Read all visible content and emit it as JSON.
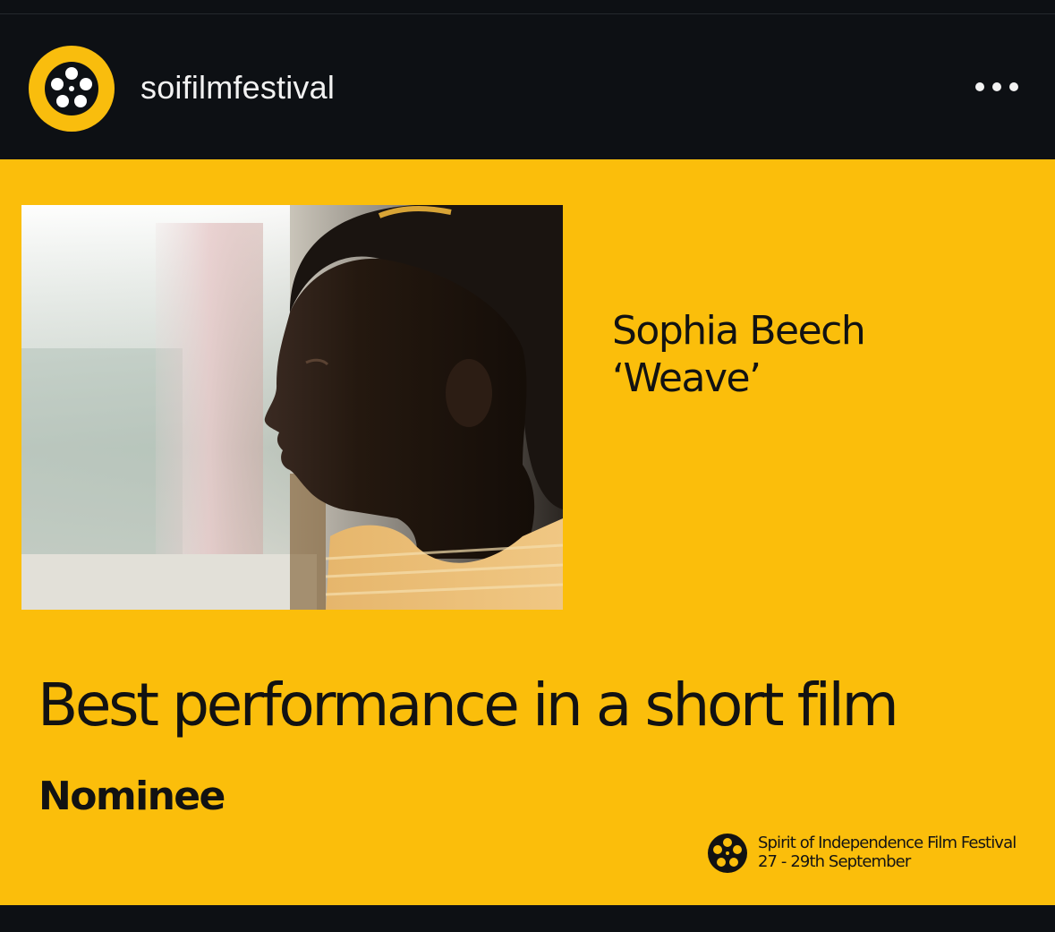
{
  "account": {
    "username": "soifilmfestival",
    "avatar_icon": "film-reel-icon",
    "more_icon": "more-options-icon"
  },
  "post": {
    "image_description_icon": "film-still-photo",
    "nominee_name": "Sophia Beech",
    "film_title": "‘Weave’",
    "award_category": "Best performance in a short film",
    "status": "Nominee",
    "festival": {
      "name": "Spirit of Independence Film Festival",
      "dates": "27 - 29th September",
      "logo_icon": "film-reel-icon"
    }
  },
  "colors": {
    "background": "#0d1014",
    "brand_yellow": "#fbbe0b",
    "text_light": "#f2f2f2",
    "text_dark": "#121212"
  }
}
